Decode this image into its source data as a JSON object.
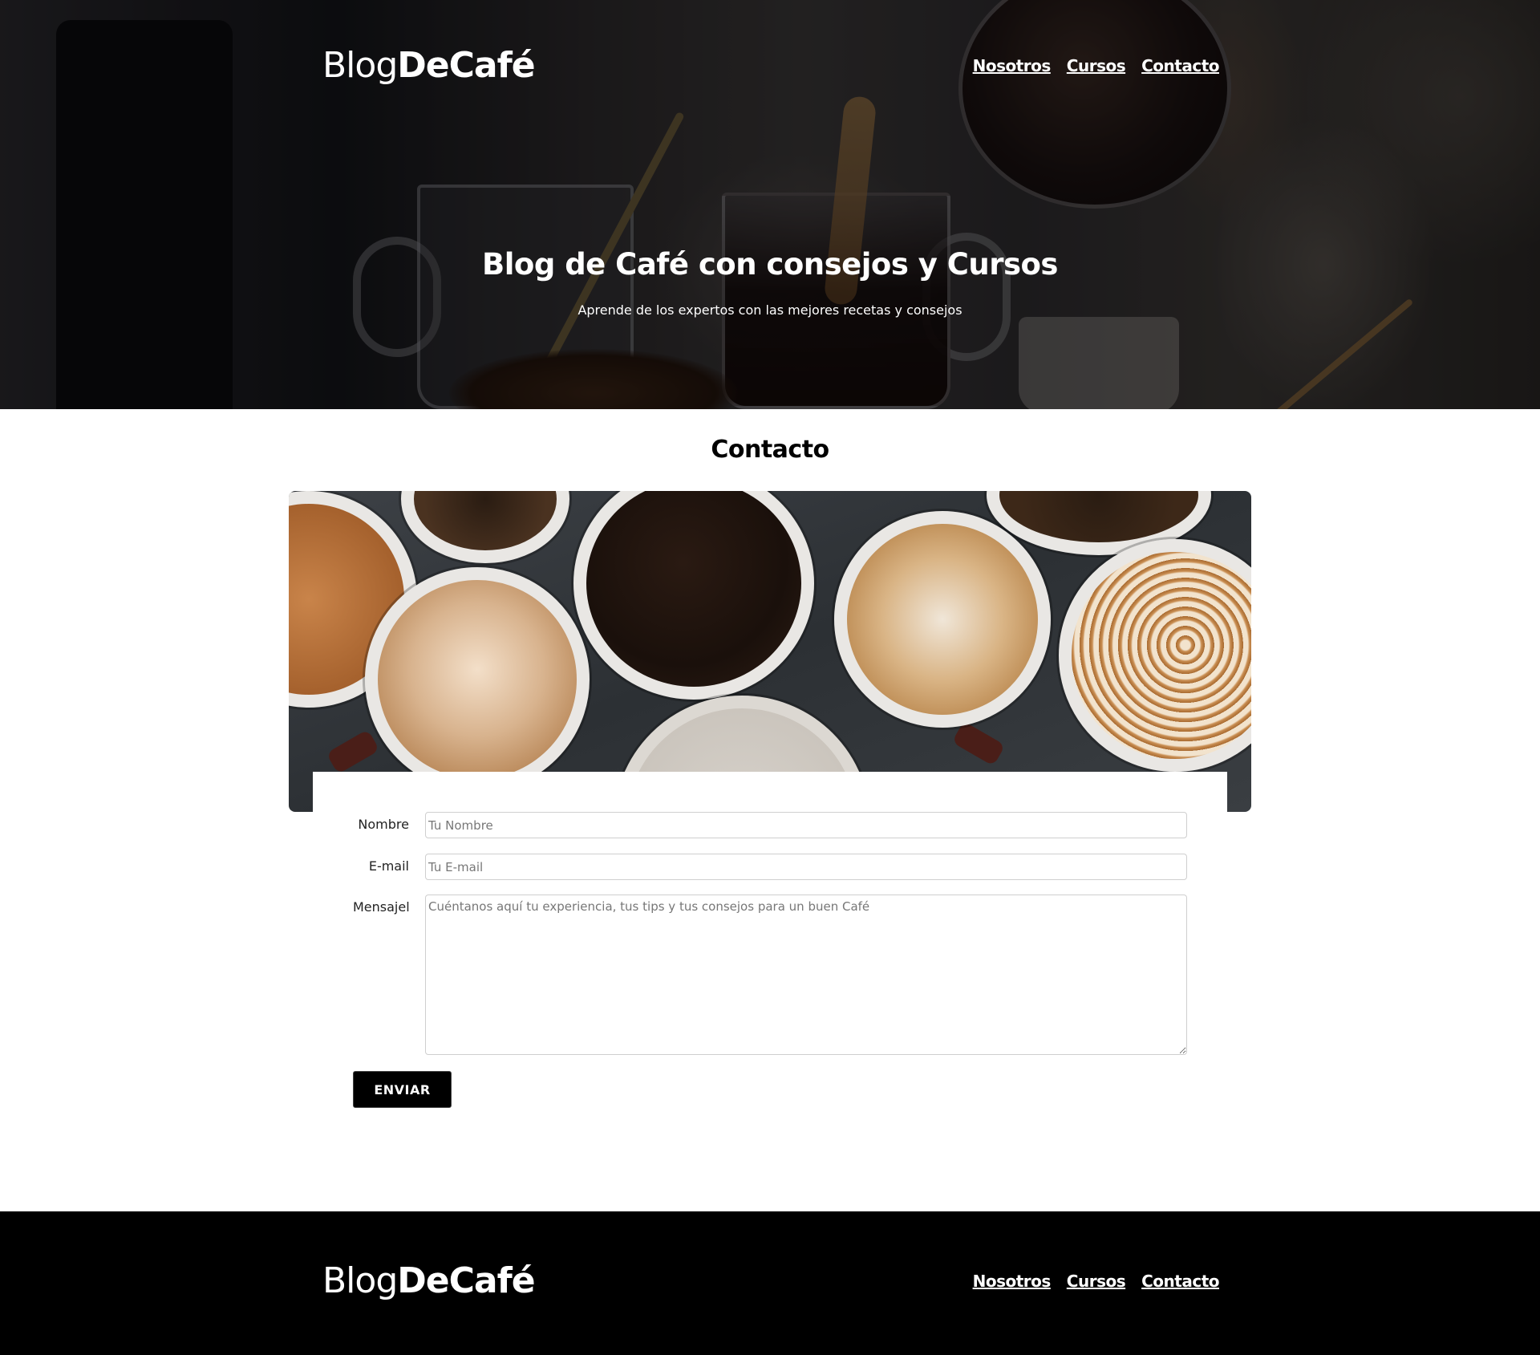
{
  "header": {
    "logo_light": "Blog",
    "logo_bold": "DeCafé",
    "nav": [
      "Nosotros",
      "Cursos",
      "Contacto"
    ]
  },
  "hero": {
    "title": "Blog de Café con consejos y Cursos",
    "subtitle": "Aprende de los expertos con las mejores recetas y consejos"
  },
  "contact": {
    "title": "Contacto",
    "form": {
      "name_label": "Nombre",
      "name_placeholder": "Tu Nombre",
      "email_label": "E-mail",
      "email_placeholder": "Tu E-mail",
      "message_label": "Mensajel",
      "message_placeholder": "Cuéntanos aquí tu experiencia, tus tips y tus consejos para un buen Café",
      "submit_label": "ENVIAR"
    }
  },
  "footer": {
    "logo_light": "Blog",
    "logo_bold": "DeCafé",
    "nav": [
      "Nosotros",
      "Cursos",
      "Contacto"
    ]
  },
  "colors": {
    "footer_bg": "#000000",
    "button_bg": "#000000",
    "text_on_dark": "#ffffff"
  }
}
